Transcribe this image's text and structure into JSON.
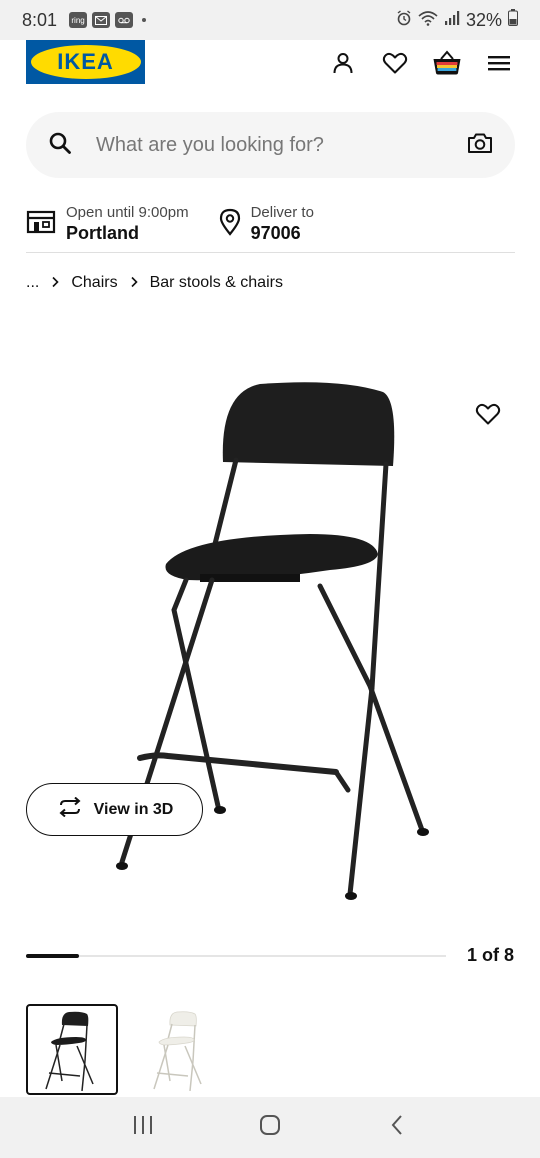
{
  "status_bar": {
    "time": "8:01",
    "mini_icons": [
      "ring",
      "mail",
      "voicemail"
    ],
    "battery": "32%"
  },
  "header": {
    "logo_text": "IKEA",
    "icons": [
      "account-icon",
      "heart-icon",
      "basket-icon",
      "menu-icon"
    ]
  },
  "search": {
    "placeholder": "What are you looking for?"
  },
  "store": {
    "open_label": "Open until 9:00pm",
    "store_name": "Portland",
    "deliver_label": "Deliver to",
    "zip": "97006"
  },
  "breadcrumb": {
    "ellipsis": "...",
    "items": [
      "Chairs",
      "Bar stools & chairs"
    ]
  },
  "product": {
    "view3d_label": "View in 3D",
    "counter": "1 of 8",
    "progress_fraction": 0.125
  },
  "colors": {
    "ikea_blue": "#0058a3",
    "ikea_yellow": "#ffdb00",
    "chair_black": "#1e1e1e",
    "chair_white": "#efeee8"
  }
}
